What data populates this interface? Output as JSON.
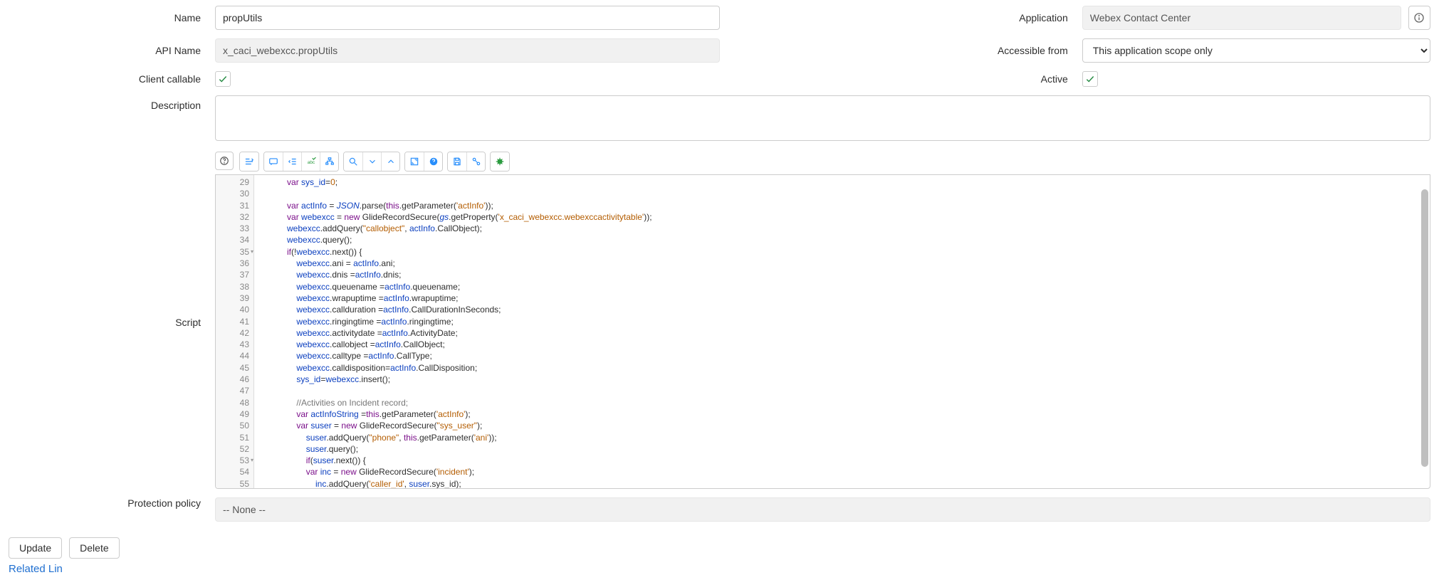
{
  "form": {
    "name": {
      "label": "Name",
      "value": "propUtils"
    },
    "apiName": {
      "label": "API Name",
      "value": "x_caci_webexcc.propUtils"
    },
    "clientCallable": {
      "label": "Client callable",
      "checked": true
    },
    "application": {
      "label": "Application",
      "value": "Webex Contact Center"
    },
    "accessibleFrom": {
      "label": "Accessible from",
      "value": "This application scope only"
    },
    "active": {
      "label": "Active",
      "checked": true
    },
    "description": {
      "label": "Description",
      "value": ""
    },
    "script": {
      "label": "Script"
    },
    "protectionPolicy": {
      "label": "Protection policy",
      "value": "-- None --"
    }
  },
  "buttons": {
    "update": "Update",
    "delete": "Delete"
  },
  "relatedLinks": "Related Lin",
  "code": {
    "startLine": 29,
    "lines": [
      {
        "n": 29,
        "html": "            <span class='tok-kw'>var</span> <span class='tok-prop'>sys_id</span>=<span class='tok-num'>0</span>;"
      },
      {
        "n": 30,
        "html": ""
      },
      {
        "n": 31,
        "html": "            <span class='tok-kw'>var</span> <span class='tok-var'>actInfo</span> = <span class='tok-em'>JSON</span>.parse(<span class='tok-kw'>this</span>.getParameter(<span class='tok-str'>'actInfo'</span>));"
      },
      {
        "n": 32,
        "html": "            <span class='tok-kw'>var</span> <span class='tok-var'>webexcc</span> = <span class='tok-kw'>new</span> GlideRecordSecure(<span class='tok-em'>gs</span>.getProperty(<span class='tok-str'>'x_caci_webexcc.webexccactivitytable'</span>));"
      },
      {
        "n": 33,
        "html": "            <span class='tok-var'>webexcc</span>.addQuery(<span class='tok-str'>\"callobject\"</span>, <span class='tok-var'>actInfo</span>.CallObject);"
      },
      {
        "n": 34,
        "html": "            <span class='tok-var'>webexcc</span>.query();"
      },
      {
        "n": 35,
        "fold": true,
        "html": "            <span class='tok-kw'>if</span>(!<span class='tok-var'>webexcc</span>.next()) {"
      },
      {
        "n": 36,
        "html": "                <span class='tok-var'>webexcc</span>.ani = <span class='tok-var'>actInfo</span>.ani;"
      },
      {
        "n": 37,
        "html": "                <span class='tok-var'>webexcc</span>.dnis =<span class='tok-var'>actInfo</span>.dnis;"
      },
      {
        "n": 38,
        "html": "                <span class='tok-var'>webexcc</span>.queuename =<span class='tok-var'>actInfo</span>.queuename;"
      },
      {
        "n": 39,
        "html": "                <span class='tok-var'>webexcc</span>.wrapuptime =<span class='tok-var'>actInfo</span>.wrapuptime;"
      },
      {
        "n": 40,
        "html": "                <span class='tok-var'>webexcc</span>.callduration =<span class='tok-var'>actInfo</span>.CallDurationInSeconds;"
      },
      {
        "n": 41,
        "html": "                <span class='tok-var'>webexcc</span>.ringingtime =<span class='tok-var'>actInfo</span>.ringingtime;"
      },
      {
        "n": 42,
        "html": "                <span class='tok-var'>webexcc</span>.activitydate =<span class='tok-var'>actInfo</span>.ActivityDate;"
      },
      {
        "n": 43,
        "html": "                <span class='tok-var'>webexcc</span>.callobject =<span class='tok-var'>actInfo</span>.CallObject;"
      },
      {
        "n": 44,
        "html": "                <span class='tok-var'>webexcc</span>.calltype =<span class='tok-var'>actInfo</span>.CallType;"
      },
      {
        "n": 45,
        "html": "                <span class='tok-var'>webexcc</span>.calldisposition=<span class='tok-var'>actInfo</span>.CallDisposition;"
      },
      {
        "n": 46,
        "html": "                <span class='tok-prop'>sys_id</span>=<span class='tok-var'>webexcc</span>.insert();"
      },
      {
        "n": 47,
        "html": ""
      },
      {
        "n": 48,
        "html": "                <span class='tok-cm'>//Activities on Incident record;</span>"
      },
      {
        "n": 49,
        "html": "                <span class='tok-kw'>var</span> <span class='tok-var'>actInfoString</span> =<span class='tok-kw'>this</span>.getParameter(<span class='tok-str'>'actInfo'</span>);"
      },
      {
        "n": 50,
        "html": "                <span class='tok-kw'>var</span> <span class='tok-var'>suser</span> = <span class='tok-kw'>new</span> GlideRecordSecure(<span class='tok-str'>\"sys_user\"</span>);"
      },
      {
        "n": 51,
        "html": "                    <span class='tok-var'>suser</span>.addQuery(<span class='tok-str'>\"phone\"</span>, <span class='tok-kw'>this</span>.getParameter(<span class='tok-str'>'ani'</span>));"
      },
      {
        "n": 52,
        "html": "                    <span class='tok-var'>suser</span>.query();"
      },
      {
        "n": 53,
        "fold": true,
        "html": "                    <span class='tok-kw'>if</span>(<span class='tok-var'>suser</span>.next()) {"
      },
      {
        "n": 54,
        "html": "                    <span class='tok-kw'>var</span> <span class='tok-var'>inc</span> = <span class='tok-kw'>new</span> GlideRecordSecure(<span class='tok-str'>'incident'</span>);"
      },
      {
        "n": 55,
        "html": "                        <span class='tok-var'>inc</span>.addQuery(<span class='tok-str'>'caller_id'</span>, <span class='tok-var'>suser</span>.sys_id);"
      }
    ]
  }
}
